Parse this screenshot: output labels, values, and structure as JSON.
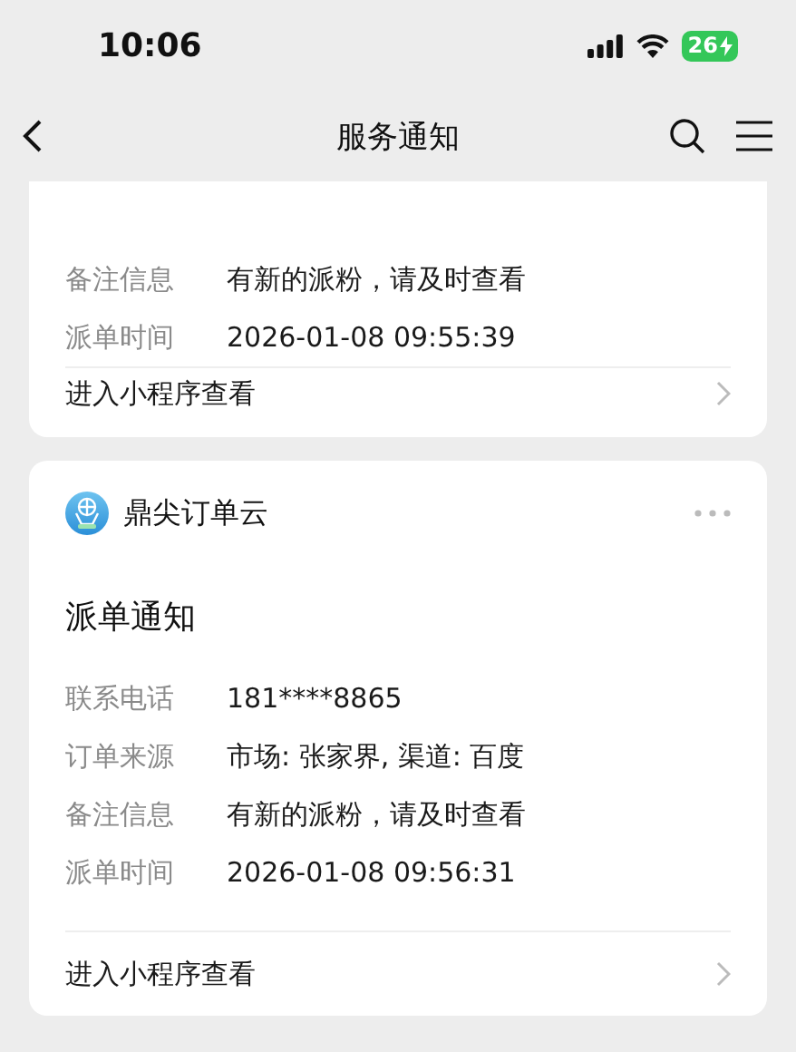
{
  "status_bar": {
    "time": "10:06",
    "battery": "26"
  },
  "nav": {
    "title": "服务通知"
  },
  "cards": [
    {
      "fields": [
        {
          "label": "备注信息",
          "value": "有新的派粉，请及时查看"
        },
        {
          "label": "派单时间",
          "value": "2026-01-08 09:55:39"
        }
      ],
      "link": "进入小程序查看"
    },
    {
      "app_name": "鼎尖订单云",
      "title": "派单通知",
      "fields": [
        {
          "label": "联系电话",
          "value": "181****8865"
        },
        {
          "label": "订单来源",
          "value": "市场: 张家界, 渠道: 百度"
        },
        {
          "label": "备注信息",
          "value": "有新的派粉，请及时查看"
        },
        {
          "label": "派单时间",
          "value": "2026-01-08 09:56:31"
        }
      ],
      "link": "进入小程序查看"
    }
  ]
}
